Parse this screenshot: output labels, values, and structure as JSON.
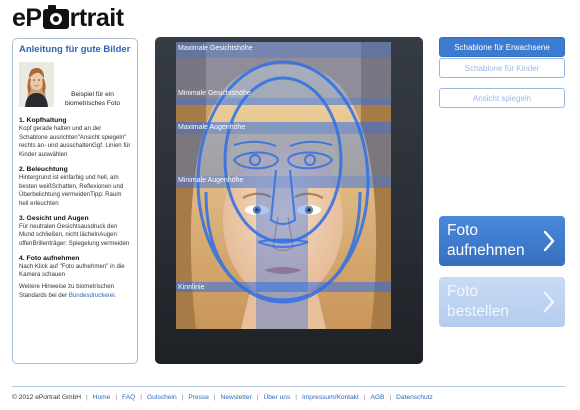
{
  "header": {
    "logo_pre": "eP",
    "logo_post": "rtrait"
  },
  "guide": {
    "title": "Anleitung für gute Bilder",
    "example_caption": "Beispiel für ein biometrisches Foto",
    "sections": [
      {
        "title": "1. Kopfhaltung",
        "text": "Kopf gerade halten und an der Schablone ausrichten\"Ansicht spiegeln\" rechts an- und ausschaltenGgf. Linien für Kinder auswählen"
      },
      {
        "title": "2. Beleuchtung",
        "text": "Hintergrund ist einfarbig und hell, am besten weißSchatten, Reflexionen und Überbelichtung vermeidenTipp: Raum hell erleuchten"
      },
      {
        "title": "3. Gesicht und Augen",
        "text": "Für neutralen Gesichtsausdruck den Mund schließen, nicht lächelnAugen offenBrillenträger: Spiegelung vermeiden"
      },
      {
        "title": "4. Foto aufnehmen",
        "text": "Nach Klick auf \"Foto aufnehmen\" in die Kamera schauen"
      }
    ],
    "hint_text": "Weitere Hinweise zu biometrischen Standards bei der ",
    "hint_link": "Bundesdruckerei",
    "hint_end": "."
  },
  "overlay": {
    "labels": [
      "Maximale Gesichtshöhe",
      "Minimale Gesichtshöhe",
      "Maximale Augenhöhe",
      "Minimale Augenhöhe",
      "Kinnlinie"
    ]
  },
  "controls": {
    "template_adult": "Schablone für Erwachsene",
    "template_child": "Schablone für Kinder",
    "mirror_view": "Ansicht spiegeln",
    "take_photo_line1": "Foto",
    "take_photo_line2": "aufnehmen",
    "order_photo_line1": "Foto",
    "order_photo_line2": "bestellen"
  },
  "footer": {
    "copyright": "© 2012 ePortrait GmbH",
    "links": [
      "Home",
      "FAQ",
      "Gutschein",
      "Presse",
      "Newsletter",
      "Über uns",
      "Impressum/Kontakt",
      "AGB",
      "Datenschutz"
    ]
  },
  "colors": {
    "accent": "#3d7bd0",
    "overlay": "#2f6fe6",
    "frame": "#2f343a",
    "muted_button": "#b8cfef"
  }
}
